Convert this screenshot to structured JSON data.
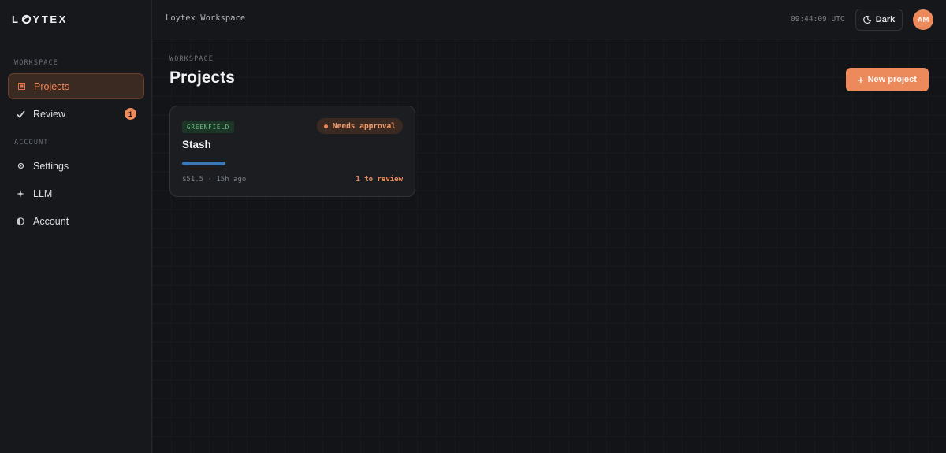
{
  "app": {
    "logo_left": "L",
    "logo_right": "YTEX"
  },
  "sidebar": {
    "sections": [
      {
        "label": "WORKSPACE",
        "items": [
          {
            "label": "Projects",
            "icon": "square-icon",
            "active": true
          },
          {
            "label": "Review",
            "icon": "check-icon",
            "badge": "1"
          }
        ]
      },
      {
        "label": "ACCOUNT",
        "items": [
          {
            "label": "Settings",
            "icon": "gear-icon"
          },
          {
            "label": "LLM",
            "icon": "sparkle-icon"
          },
          {
            "label": "Account",
            "icon": "half-circle-icon"
          }
        ]
      }
    ]
  },
  "topbar": {
    "workspace_title": "Loytex Workspace",
    "clock": "09:44:09 UTC",
    "theme_label": "Dark",
    "theme_icon": "moon-icon",
    "avatar_initials": "AM"
  },
  "main": {
    "eyebrow": "WORKSPACE",
    "title": "Projects",
    "new_button": {
      "icon": "+",
      "label": "New project"
    },
    "projects": [
      {
        "tag": "GREENFIELD",
        "status": "Needs approval",
        "name": "Stash",
        "progress": 1.0,
        "meta": "$51.5 · 15h ago",
        "review": "1 to review"
      }
    ]
  },
  "colors": {
    "accent": "#ec8a5b",
    "background": "#121417",
    "sidebar": "#16181c",
    "tag_green": "#6ec48a",
    "progress_blue": "#3d78b4"
  }
}
